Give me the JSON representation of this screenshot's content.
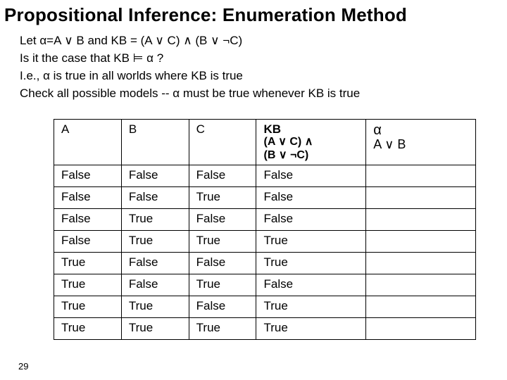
{
  "title": "Propositional Inference: Enumeration Method",
  "lines": {
    "l1": "Let α=A ∨ B  and  KB =  (A ∨ C) ∧ (B ∨ ¬C)",
    "l2": "Is it the case that KB   ⊨  α ?",
    "l3": "I.e., α is true in all worlds where KB is true",
    "l4": "Check all possible models -- α must be true whenever KB is true"
  },
  "headers": {
    "A": "A",
    "B": "B",
    "C": "C",
    "KB_top": "KB",
    "KB_sub1": "(A ∨ C) ∧",
    "KB_sub2": "(B ∨ ¬C)",
    "alpha_top": "α",
    "alpha_sub": "A ∨ B"
  },
  "rows": [
    {
      "A": "False",
      "B": "False",
      "C": "False",
      "KB": "False",
      "a": ""
    },
    {
      "A": "False",
      "B": "False",
      "C": "True",
      "KB": "False",
      "a": ""
    },
    {
      "A": "False",
      "B": "True",
      "C": "False",
      "KB": "False",
      "a": ""
    },
    {
      "A": "False",
      "B": "True",
      "C": "True",
      "KB": "True",
      "a": ""
    },
    {
      "A": "True",
      "B": "False",
      "C": "False",
      "KB": "True",
      "a": ""
    },
    {
      "A": "True",
      "B": "False",
      "C": "True",
      "KB": "False",
      "a": ""
    },
    {
      "A": "True",
      "B": "True",
      "C": "False",
      "KB": "True",
      "a": ""
    },
    {
      "A": "True",
      "B": "True",
      "C": "True",
      "KB": "True",
      "a": ""
    }
  ],
  "slideNumber": "29"
}
